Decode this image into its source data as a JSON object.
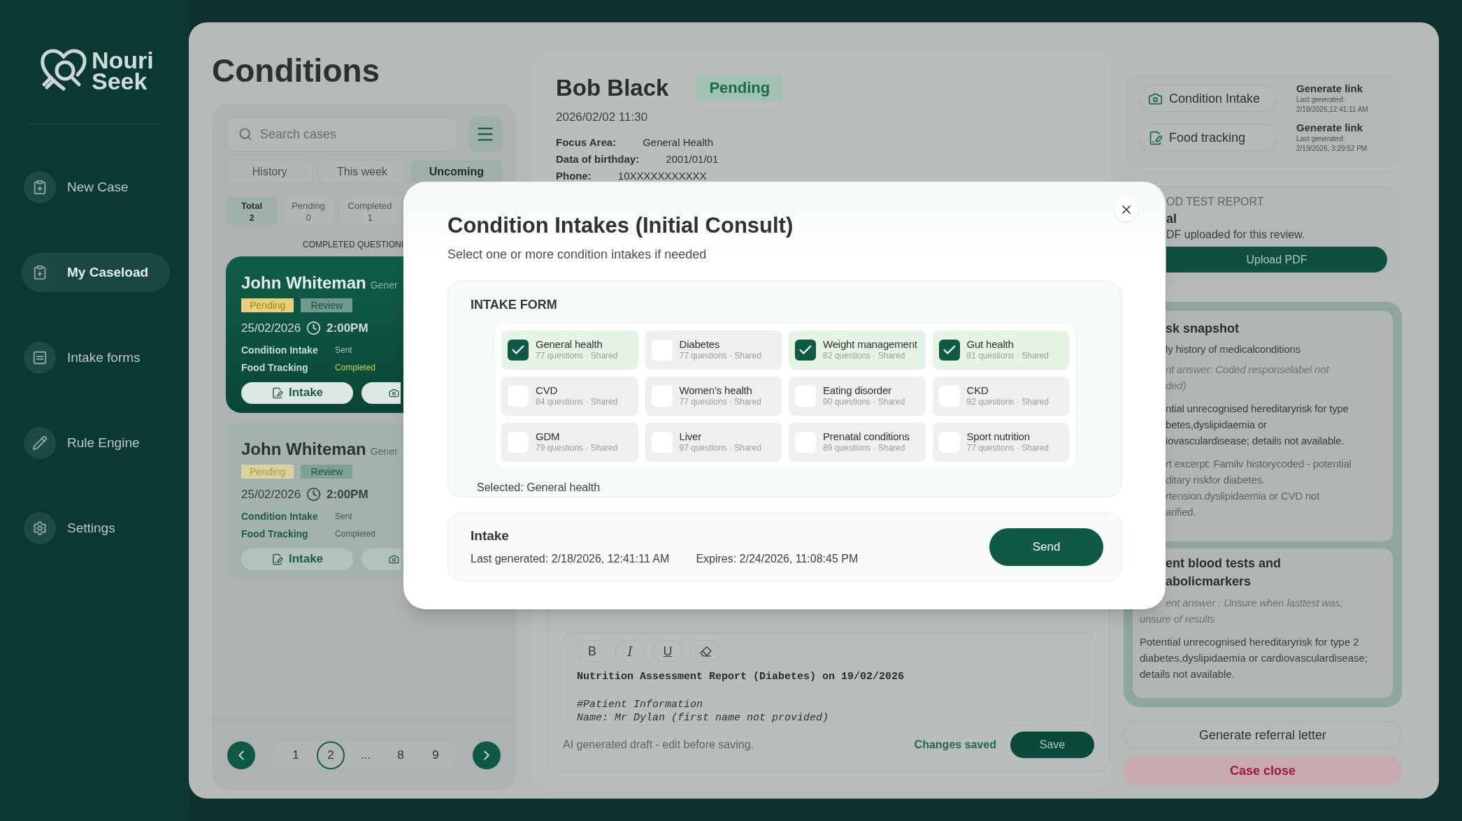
{
  "sidebar": {
    "logo": {
      "line1": "Nouri",
      "line2": "Seek"
    },
    "items": [
      {
        "label": "New Case",
        "selected": false
      },
      {
        "label": "My Caseload",
        "selected": true
      },
      {
        "label": "Intake forms",
        "selected": false
      },
      {
        "label": "Rule Engine",
        "selected": false
      },
      {
        "label": "Settings",
        "selected": false
      }
    ]
  },
  "page_title": "Conditions",
  "case_list": {
    "search": {
      "placeholder": "Search cases"
    },
    "tabs": [
      {
        "label": "History",
        "selected": false
      },
      {
        "label": "This week",
        "selected": false
      },
      {
        "label": "Uncoming",
        "selected": true
      }
    ],
    "stats": [
      {
        "label": "Total",
        "value": "2",
        "selected": true
      },
      {
        "label": "Pending",
        "value": "0",
        "selected": false
      },
      {
        "label": "Completed",
        "value": "1",
        "selected": false
      }
    ],
    "section_label": "COMPLETED QUESTIONI",
    "cards": [
      {
        "name": "John Whiteman",
        "focus": "Gener",
        "status": "Pending",
        "tag": "Review",
        "date": "25/02/2026",
        "time": "2:00PM",
        "rows": [
          {
            "label": "Condition Intake",
            "value": "Sent"
          },
          {
            "label": "Food Tracking",
            "value": "Completed"
          }
        ],
        "button": "Intake",
        "selected": true
      },
      {
        "name": "John Whiteman",
        "focus": "Gener",
        "status": "Pending",
        "tag": "Review",
        "date": "25/02/2026",
        "time": "2:00PM",
        "rows": [
          {
            "label": "Condition Intake",
            "value": "Sent"
          },
          {
            "label": "Food Tracking",
            "value": "Completed"
          }
        ],
        "button": "Intake",
        "selected": false
      }
    ],
    "pagination": [
      {
        "label": "1",
        "selected": false
      },
      {
        "label": "2",
        "selected": true
      },
      {
        "label": "...",
        "selected": false
      },
      {
        "label": "8",
        "selected": false
      },
      {
        "label": "9",
        "selected": false
      }
    ]
  },
  "case_detail": {
    "name": "Bob Black",
    "status": "Pending",
    "datetime": "2026/02/02 11:30",
    "fields": [
      {
        "label": "Focus Area:",
        "value": "General Health"
      },
      {
        "label": "Data of birthday:",
        "value": "2001/01/01"
      },
      {
        "label": "Phone:",
        "value": "10XXXXXXXXXXX"
      }
    ],
    "editor": {
      "toolbar": [
        "B",
        "I",
        "U"
      ],
      "heading": "Nutrition Assessment Report (Diabetes) on 19/02/2026",
      "lines": [
        "#Patient Information",
        "Name: Mr Dylan (first name not provided)"
      ],
      "note": "AI generated draft - edit before saving.",
      "save_status": "Changes saved",
      "save_button": "Save"
    }
  },
  "side_panel": {
    "links": [
      {
        "label": "Condition Intake",
        "action": "Generate link",
        "caption": "Last generated:",
        "time": "2/18/2026,12:41:11 AM"
      },
      {
        "label": "Food tracking",
        "action": "Generate link",
        "caption": "Last generated:",
        "time": "2/19/2026, 3:29:52 PM"
      }
    ],
    "blood_test": {
      "title": "OD TEST REPORT",
      "status": "al",
      "note": "DF uploaded for this review.",
      "button": "Upload PDF"
    },
    "risk_snapshot": {
      "title": "sk snapshot",
      "question": "ly history of medicalconditions",
      "answer": [
        "nt answer: Coded responselabel not",
        "ded)"
      ],
      "paragraphs": [
        [
          "ntial unrecognised hereditaryrisk for type",
          "betes,dyslipidaemia or",
          "iovasculardisease; details not available."
        ],
        [
          "rt excerpt: Familv historycoded - potential",
          "ditary riskfor diabetes.",
          "rtension.dyslipidaemia or CVD not",
          "arified."
        ]
      ]
    },
    "blood_markers": {
      "title": [
        "ent blood tests and",
        "abolicmarkers"
      ],
      "answer": [
        "ent answer : Unsure when lasttest was;",
        "unsure of results"
      ],
      "paragraph": "Potential unrecognised hereditaryrisk for type 2 diabetes,dyslipidaemia or cardiovasculardisease; details not available."
    },
    "buttons": [
      {
        "label": "Generate referral letter",
        "kind": "neutral"
      },
      {
        "label": "Case close",
        "kind": "danger"
      }
    ]
  },
  "modal": {
    "title": "Condition Intakes (Initial Consult)",
    "subtitle": "Select one or more condition intakes if needed",
    "section_title": "INTAKE FORM",
    "options": [
      {
        "name": "General health",
        "meta": "77 questions · Shared",
        "checked": true
      },
      {
        "name": "Diabetes",
        "meta": "77 questions · Shared",
        "checked": false
      },
      {
        "name": "Weight management",
        "meta": "82 questions · Shared",
        "checked": true
      },
      {
        "name": "Gut health",
        "meta": "81 questions · Shared",
        "checked": true
      },
      {
        "name": "CVD",
        "meta": "84 questions · Shared",
        "checked": false
      },
      {
        "name": "Women’s health",
        "meta": "77 questions · Shared",
        "checked": false
      },
      {
        "name": "Eating disorder",
        "meta": "90 questions · Shared",
        "checked": false
      },
      {
        "name": "CKD",
        "meta": "92 questions · Shared",
        "checked": false
      },
      {
        "name": "GDM",
        "meta": "79 questions · Shared",
        "checked": false
      },
      {
        "name": "Liver",
        "meta": "97 questions · Shared",
        "checked": false
      },
      {
        "name": "Prenatal conditions",
        "meta": "89 questions · Shared",
        "checked": false
      },
      {
        "name": "Sport nutrition",
        "meta": "77 questions · Shared",
        "checked": false
      }
    ],
    "selected_text": "Selected: General health",
    "intake": {
      "title": "Intake",
      "last_generated": "Last generated: 2/18/2026, 12:41:11 AM",
      "expires": "Expires: 2/24/2026, 11:08:45 PM",
      "button": "Send"
    }
  }
}
